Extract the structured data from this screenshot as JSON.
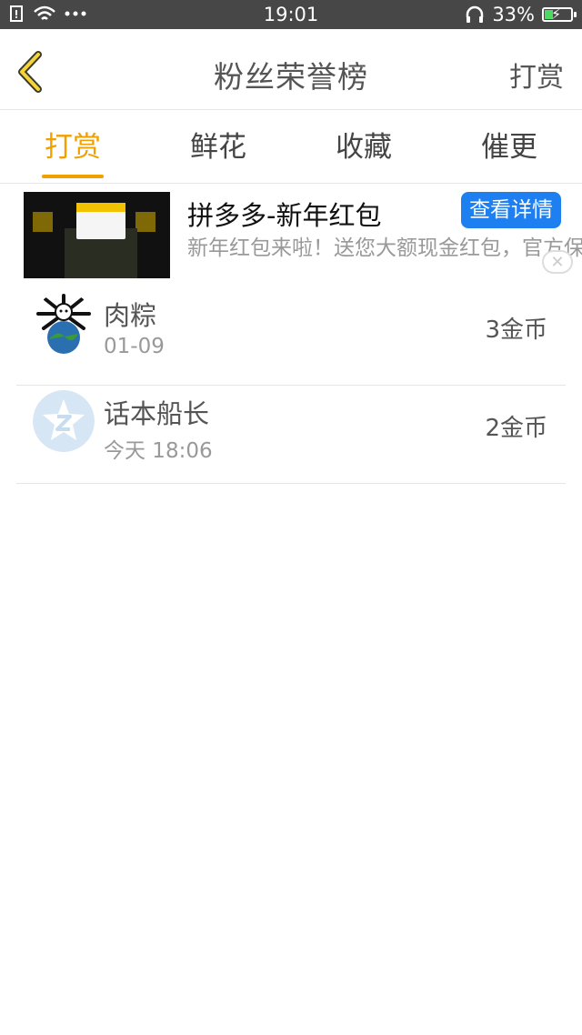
{
  "status_bar": {
    "time": "19:01",
    "battery": "33%",
    "battery_level": 0.33
  },
  "header": {
    "title": "粉丝荣誉榜",
    "reward_button": "打赏",
    "back_icon": "chevron-left-icon"
  },
  "tabs": [
    {
      "label": "打赏",
      "active": true
    },
    {
      "label": "鲜花",
      "active": false
    },
    {
      "label": "收藏",
      "active": false
    },
    {
      "label": "催更",
      "active": false
    }
  ],
  "ad": {
    "title": "拼多多-新年红包",
    "description": "新年红包来啦！送您大额现金红包，官方保证，真实有效！",
    "button": "查看详情",
    "close_icon": "close-icon"
  },
  "list": [
    {
      "name": "肉粽",
      "date": "01-09",
      "coins": "3金币"
    },
    {
      "name": "话本船长",
      "date": "今天 18:06",
      "coins": "2金币"
    }
  ],
  "colors": {
    "accent": "#f0a000",
    "ad_button": "#1d7ff0",
    "status_bar": "#474747"
  }
}
